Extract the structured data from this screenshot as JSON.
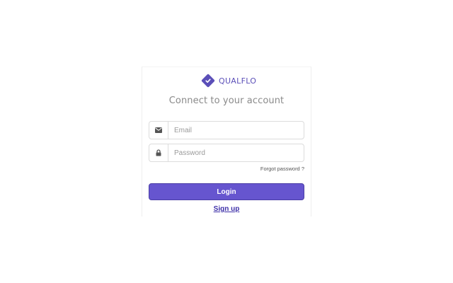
{
  "brand": {
    "name": "QUALFLO",
    "accent_color": "#6655cf",
    "logo_icon": "diamond-check-icon"
  },
  "login_form": {
    "heading": "Connect to your account",
    "email": {
      "icon": "envelope-icon",
      "placeholder": "Email",
      "value": ""
    },
    "password": {
      "icon": "lock-icon",
      "placeholder": "Password",
      "value": ""
    },
    "forgot_password_label": "Forgot password ?",
    "login_button_label": "Login",
    "signup_link_label": "Sign up"
  }
}
